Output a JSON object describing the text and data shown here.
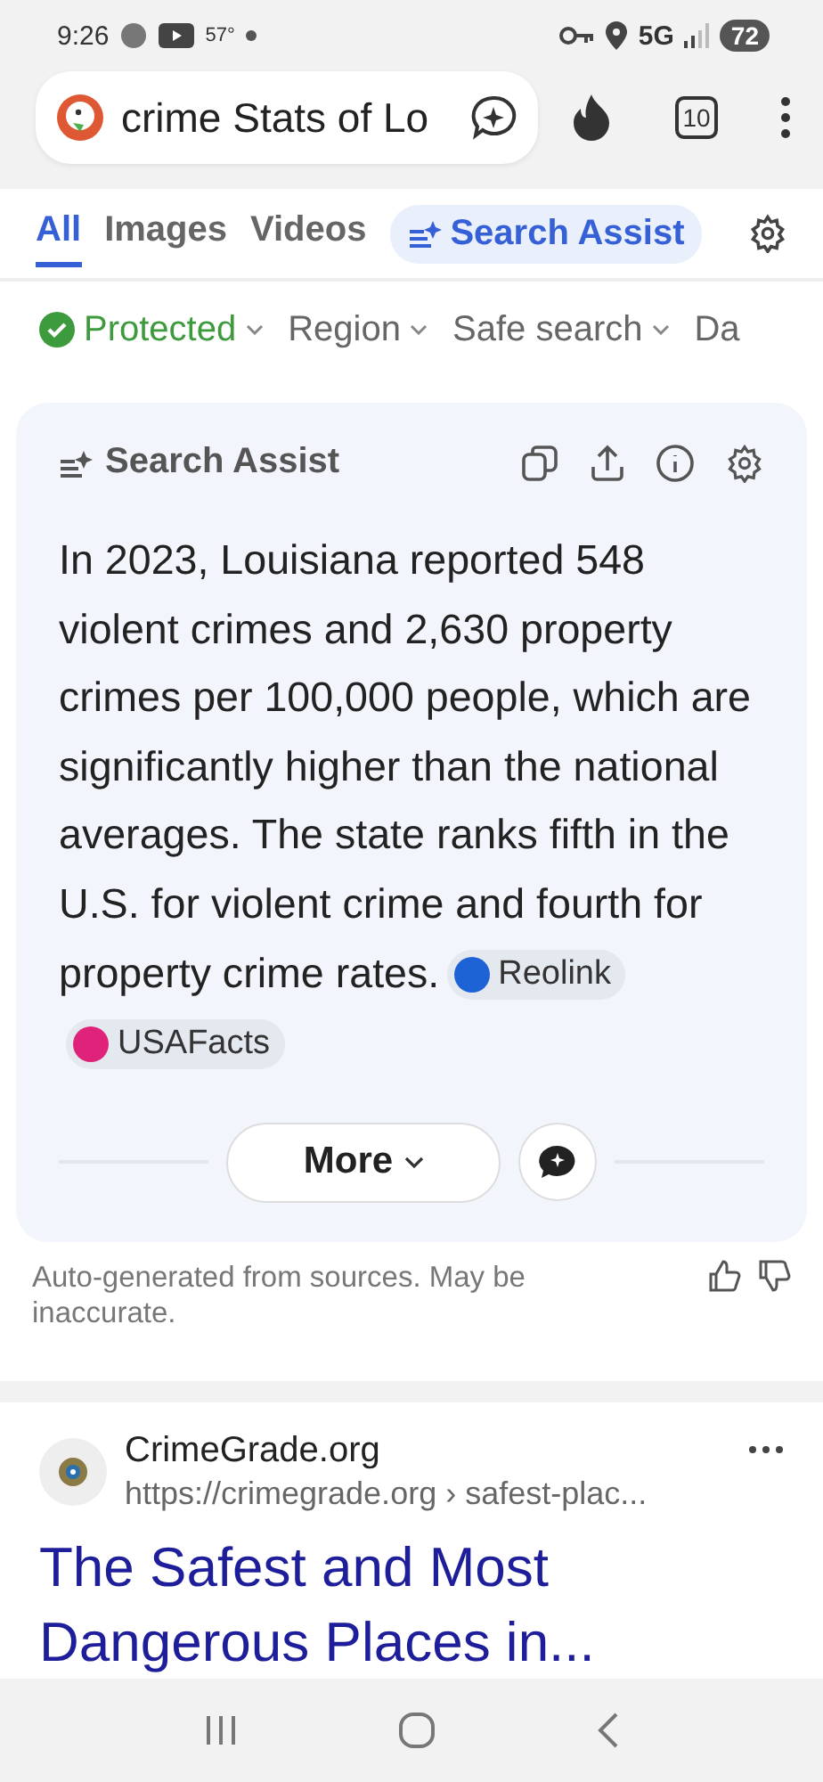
{
  "status_bar": {
    "time": "9:26",
    "temperature": "57°",
    "network": "5G",
    "battery": "72"
  },
  "address_bar": {
    "query": "crime Stats of Lo",
    "tab_count": "10"
  },
  "tabs": [
    {
      "label": "All",
      "selected": true
    },
    {
      "label": "Images",
      "selected": false
    },
    {
      "label": "Videos",
      "selected": false
    },
    {
      "label": "Search Assist",
      "selected": false,
      "kind": "assist"
    }
  ],
  "filters": [
    {
      "label": "Protected",
      "kind": "protected"
    },
    {
      "label": "Region",
      "kind": "dropdown"
    },
    {
      "label": "Safe search",
      "kind": "dropdown"
    },
    {
      "label": "Da",
      "kind": "cut"
    }
  ],
  "assist": {
    "title": "Search Assist",
    "answer": "In 2023, Louisiana reported 548 violent crimes and 2,630 property crimes per 100,000 people, which are significantly higher than the national averages. The state ranks fifth in the U.S. for violent crime and fourth for property crime rates.",
    "sources": [
      {
        "name": "Reolink",
        "color": "#1e63d6"
      },
      {
        "name": "USAFacts",
        "color": "#e0237a"
      }
    ],
    "more_button": "More"
  },
  "disclaimer": "Auto-generated from sources. May be inaccurate.",
  "result": {
    "site": "CrimeGrade.org",
    "url": "https://crimegrade.org › safest-plac...",
    "title": "The Safest and Most Dangerous Places in..."
  }
}
